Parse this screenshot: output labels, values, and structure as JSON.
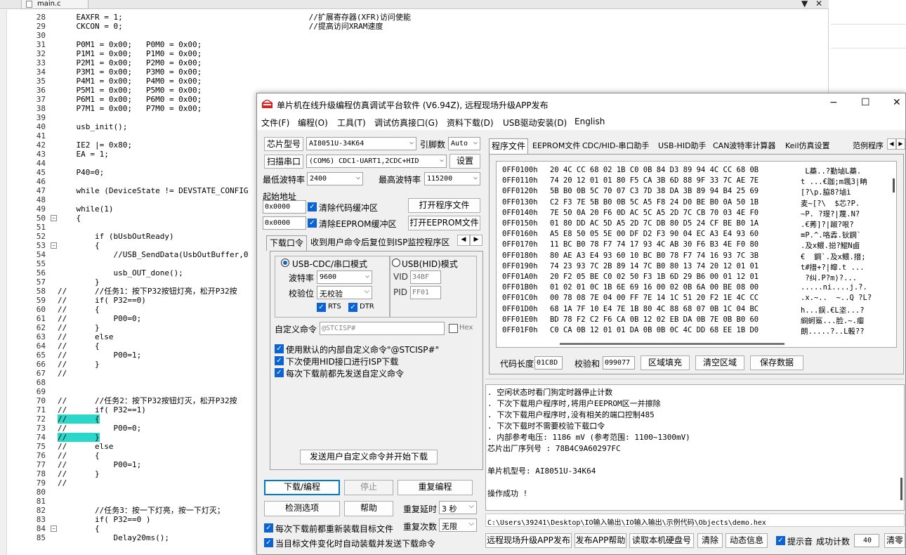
{
  "editor": {
    "tab_label": "main.c",
    "tab_controls": [
      "▼",
      "✕"
    ],
    "lines": [
      {
        "n": "28",
        "code": "    EAXFR = 1;                                        //扩展寄存器(XFR)访问使能"
      },
      {
        "n": "29",
        "code": "    CKCON = 0;                                        //提高访问XRAM速度"
      },
      {
        "n": "30",
        "code": ""
      },
      {
        "n": "31",
        "code": "    P0M1 = 0x00;   P0M0 = 0x00;"
      },
      {
        "n": "32",
        "code": "    P1M1 = 0x00;   P1M0 = 0x00;"
      },
      {
        "n": "33",
        "code": "    P2M1 = 0x00;   P2M0 = 0x00;"
      },
      {
        "n": "34",
        "code": "    P3M1 = 0x00;   P3M0 = 0x00;"
      },
      {
        "n": "35",
        "code": "    P4M1 = 0x00;   P4M0 = 0x00;"
      },
      {
        "n": "36",
        "code": "    P5M1 = 0x00;   P5M0 = 0x00;"
      },
      {
        "n": "37",
        "code": "    P6M1 = 0x00;   P6M0 = 0x00;"
      },
      {
        "n": "38",
        "code": "    P7M1 = 0x00;   P7M0 = 0x00;"
      },
      {
        "n": "39",
        "code": ""
      },
      {
        "n": "40",
        "code": "    usb_init();"
      },
      {
        "n": "41",
        "code": ""
      },
      {
        "n": "42",
        "code": "    IE2 |= 0x80;"
      },
      {
        "n": "43",
        "code": "    EA = 1;"
      },
      {
        "n": "44",
        "code": ""
      },
      {
        "n": "45",
        "code": "    P40=0;"
      },
      {
        "n": "46",
        "code": ""
      },
      {
        "n": "47",
        "code": "    while (DeviceState != DEVSTATE_CONFIG"
      },
      {
        "n": "48",
        "code": ""
      },
      {
        "n": "49",
        "code": "    while(1)"
      },
      {
        "n": "50",
        "code": "    {",
        "fold": "−"
      },
      {
        "n": "51",
        "code": ""
      },
      {
        "n": "52",
        "code": "        if (bUsbOutReady)"
      },
      {
        "n": "53",
        "code": "        {",
        "fold": "−"
      },
      {
        "n": "54",
        "code": "            //USB_SendData(UsbOutBuffer,0"
      },
      {
        "n": "55",
        "code": ""
      },
      {
        "n": "56",
        "code": "            usb_OUT_done();"
      },
      {
        "n": "57",
        "code": "        }"
      },
      {
        "n": "58",
        "code": "//      //任务1：按下P32按钮灯亮，松开P32按"
      },
      {
        "n": "59",
        "code": "//      if( P32==0)"
      },
      {
        "n": "60",
        "code": "//      {"
      },
      {
        "n": "61",
        "code": "//          P00=0;"
      },
      {
        "n": "62",
        "code": "//      }"
      },
      {
        "n": "63",
        "code": "//      else"
      },
      {
        "n": "64",
        "code": "//      {"
      },
      {
        "n": "65",
        "code": "//          P00=1;"
      },
      {
        "n": "66",
        "code": "//      }"
      },
      {
        "n": "67",
        "code": "//"
      },
      {
        "n": "68",
        "code": ""
      },
      {
        "n": "69",
        "code": ""
      },
      {
        "n": "70",
        "code": "//      //任务2：按下P32按钮灯灭，松开P32按"
      },
      {
        "n": "71",
        "code": "//      if( P32==1)"
      },
      {
        "n": "72",
        "code": "//      {",
        "hl": true
      },
      {
        "n": "73",
        "code": "//          P00=0;"
      },
      {
        "n": "74",
        "code": "//      }",
        "hl": true
      },
      {
        "n": "75",
        "code": "//      else"
      },
      {
        "n": "76",
        "code": "//      {"
      },
      {
        "n": "77",
        "code": "//          P00=1;"
      },
      {
        "n": "78",
        "code": "//      }"
      },
      {
        "n": "79",
        "code": "//"
      },
      {
        "n": "80",
        "code": ""
      },
      {
        "n": "81",
        "code": ""
      },
      {
        "n": "82",
        "code": "        //任务3：按一下灯亮，按一下灯灭；"
      },
      {
        "n": "83",
        "code": "        if( P32==0 )"
      },
      {
        "n": "84",
        "code": "        {",
        "fold": "−"
      },
      {
        "n": "85",
        "code": "            Delay20ms();"
      }
    ]
  },
  "isp": {
    "title": "单片机在线升级编程仿真调试平台软件 (V6.94Z), 远程现场升级APP发布",
    "window_controls": [
      "−",
      "☐",
      "✕"
    ],
    "menu": [
      "文件(F)",
      "编程(O)",
      "工具(T)",
      "调试仿真接口(G)",
      "资料下载(D)",
      "USB驱动安装(D)",
      "English"
    ],
    "chip_model_btn": "芯片型号",
    "chip_model": "AI8051U-34K64",
    "pin_label": "引脚数",
    "pin_value": "Auto",
    "scan_port_btn": "扫描串口",
    "port_value": "(COM6) CDC1-UART1,2CDC+HID",
    "settings_btn": "设置",
    "min_baud_label": "最低波特率",
    "min_baud": "2400",
    "max_baud_label": "最高波特率",
    "max_baud": "115200",
    "start_addr_label": "起始地址",
    "addr1": "0x0000",
    "clear_code_cb": "清除代码缓冲区",
    "open_prog_btn": "打开程序文件",
    "addr2": "0x0000",
    "clear_eeprom_cb": "清除EEPROM缓冲区",
    "open_eeprom_btn": "打开EEPROM文件",
    "left_tabs": [
      "下载口令",
      "收到用户命令后复位到ISP监控程序区"
    ],
    "usb_cdc_mode": "USB-CDC/串口模式",
    "usb_hid_mode": "USB(HID)模式",
    "baud_label": "波特率",
    "baud_value": "9600",
    "parity_label": "校验位",
    "parity_value": "无校验",
    "rts": "RTS",
    "dtr": "DTR",
    "vid_label": "VID",
    "vid_value": "34BF",
    "pid_label": "PID",
    "pid_value": "FF01",
    "custom_cmd_label": "自定义命令",
    "custom_cmd_value": "@STCISP#",
    "hex_label": "Hex",
    "cb_use_default": "使用默认的内部自定义命令\"@STCISP#\"",
    "cb_next_hid": "下次使用HID接口进行ISP下载",
    "cb_send_before": "每次下载前都先发送自定义命令",
    "send_cmd_btn": "发送用户自定义命令并开始下载",
    "download_btn": "下载/编程",
    "stop_btn": "停止",
    "reprogram_btn": "重复编程",
    "check_btn": "检测选项",
    "help_btn": "帮助",
    "repeat_delay_label": "重复延时",
    "repeat_delay_value": "3 秒",
    "repeat_count_label": "重复次数",
    "repeat_count_value": "无限",
    "cb_reload": "每次下载前都重新装载目标文件",
    "cb_auto": "当目标文件变化时自动装载并发送下载命令",
    "right_tabs": [
      "程序文件",
      "EEPROM文件",
      "CDC/HID-串口助手",
      "USB-HID助手",
      "CAN波特率计算器",
      "Keil仿真设置",
      "范例程序"
    ],
    "hex_rows": [
      {
        "addr": "0FF0100h",
        "bytes": "20 4C CC 68 02 1B C0 0B 84 D3 89 94 4C CC 68 0B",
        "asc": " L蘃..?勤塷L蘃."
      },
      {
        "addr": "0FF0110h",
        "bytes": "74 20 12 01 01 80 F5 CA 3B 6D 88 9F 33 7C AE 7E",
        "asc": "t ...€跏;m堸3|畘"
      },
      {
        "addr": "0FF0120h",
        "bytes": "5B B0 0B 5C 70 07 C3 7D 38 DA 3B 89 94 B4 25 69",
        "asc": "[?\\p.脇8?塷ì"
      },
      {
        "addr": "0FF0130h",
        "bytes": "C2 F3 7E 5B B0 0B 5C A5 F8 24 D0 BE B0 0A 50 1B",
        "asc": "麦~[?\\  $芯?P."
      },
      {
        "addr": "0FF0140h",
        "bytes": "7E 50 0A 20 F6 0D AC 5C A5 2D 7C CB 70 03 4E F0",
        "asc": "~P. ?琝?|蔑.N?"
      },
      {
        "addr": "0FF0150h",
        "bytes": "01 80 DD AC 5D A5 2D 7C DB 80 D5 24 CF BE B0 1A",
        "asc": ".€莠]?|踧?哏?"
      },
      {
        "addr": "0FF0160h",
        "bytes": "A5 E8 50 05 5E 00 DF D2 F3 90 04 EC A3 E4 93 60",
        "asc": "≡P.^.咯掱.钬鋼`"
      },
      {
        "addr": "0FF0170h",
        "bytes": "11 BC B0 78 F7 74 17 93 4C AB 30 F6 B3 4E F0 80",
        "asc": ".及x鳂.搃?鯤N鹵"
      },
      {
        "addr": "0FF0180h",
        "bytes": "80 AE A3 E4 93 60 10 BC B0 78 F7 74 16 93 7C 3B",
        "asc": "€  鋼`.及x鳂.搢;"
      },
      {
        "addr": "0FF0190h",
        "bytes": "74 23 93 7C 2B 89 14 7C B0 80 13 74 20 12 01 01",
        "asc": "t#搢+?|皡.t ..."
      },
      {
        "addr": "0FF01A0h",
        "bytes": "20 F2 05 BE C0 02 50 F3 1B 6D 29 B6 00 01 12 01",
        "asc": " ?纠.P?m)?..."
      },
      {
        "addr": "0FF01B0h",
        "bytes": "01 02 01 0C 1B 6E 69 16 00 02 0B 6A 00 BE 08 00",
        "asc": ".....ni....j.?."
      },
      {
        "addr": "0FF01C0h",
        "bytes": "00 78 08 7E 04 00 FF 7E 14 1C 51 20 F2 1E 4C CC",
        "asc": ".x.~..  ~..Q ?L?"
      },
      {
        "addr": "0FF01D0h",
        "bytes": "68 1A 7F 10 E4 7E 1B 80 4C 88 68 07 0B 1C 04 BC",
        "asc": "h...鋘.€L垐...?"
      },
      {
        "addr": "0FF01E0h",
        "bytes": "BD 78 F2 C2 F6 CA 0B 12 02 EB DA 0B 7E 0B B0 60",
        "asc": "綗蚵鯊...脸.~.瘿"
      },
      {
        "addr": "0FF01F0h",
        "bytes": "C0 CA 0B 12 01 01 DA 0B 0B 0C 4C DD 68 EE 1B D0",
        "asc": "朗.....?..L軗??"
      }
    ],
    "code_len_label": "代码长度",
    "code_len": "01C8D",
    "checksum_label": "校验和",
    "checksum": "099077",
    "fill_btn": "区域填充",
    "clear_area_btn": "清空区域",
    "save_btn": "保存数据",
    "log_lines": [
      "  . 空闲状态时看门狗定时器停止计数",
      "  . 下次下载用户程序时,将用户EEPROM区一并擦除",
      "  . 下次下载用户程序时,没有相关的端口控制485",
      "  . 下次下载时不需要校验下载口令",
      "  . 内部参考电压: 1186 mV (参考范围: 1100~1300mV)",
      "芯片出厂序列号 : 78B4C9A60297FC",
      "",
      "  单片机型号: AI8051U-34K64",
      "",
      "操作成功 !"
    ],
    "file_path": "C:\\Users\\39241\\Desktop\\IO输入输出\\IO输入输出\\示例代码\\Objects\\demo.hex",
    "bottom_buttons": [
      "远程现场升级APP发布",
      "发布APP帮助",
      "读取本机硬盘号",
      "清除",
      "动态信息"
    ],
    "beep_label": "提示音",
    "success_label": "成功计数",
    "success_count": "40",
    "reset_btn": "清零"
  }
}
